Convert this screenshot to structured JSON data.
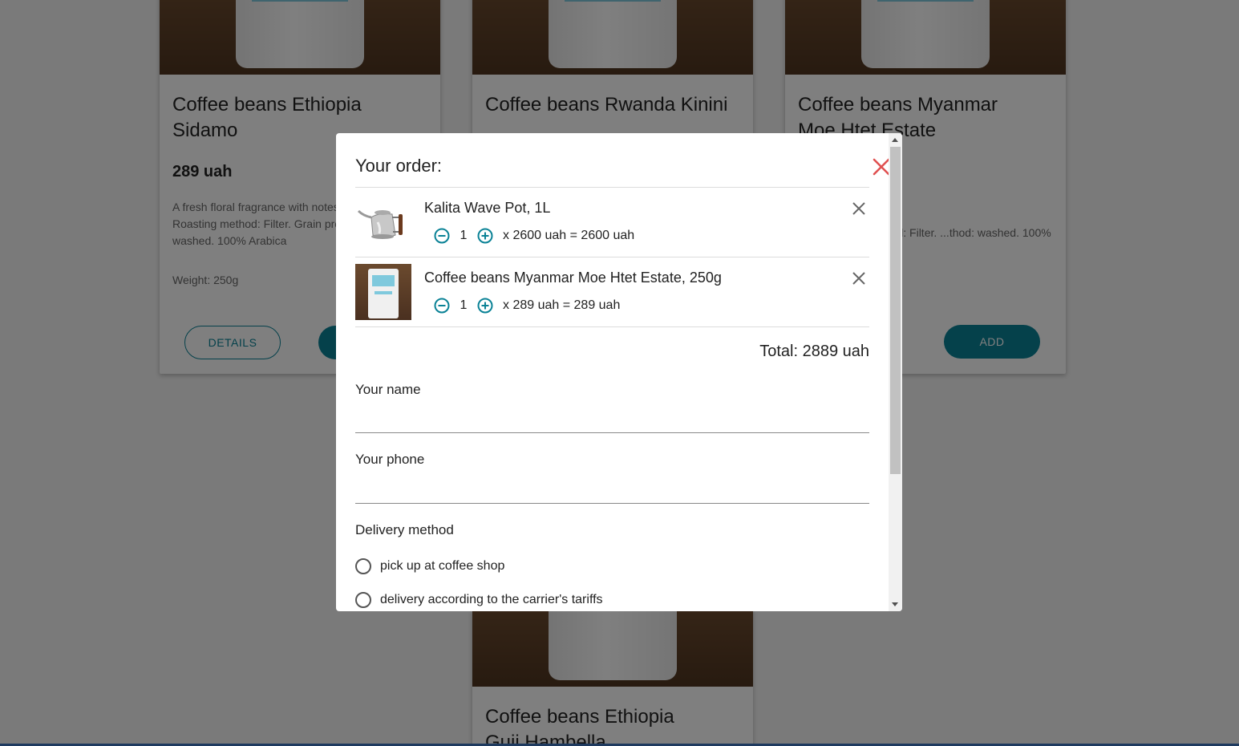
{
  "products": [
    {
      "title": "Coffee beans Ethiopia Sidamo",
      "price": "289 uah",
      "description": "A fresh floral fragrance with notes of bergamot. Roasting method: Filter. Grain processing method: washed. 100% Arabica",
      "weight": "Weight: 250g",
      "details_label": "DETAILS",
      "add_label": "ADD"
    },
    {
      "title": "Coffee beans Rwanda Kinini"
    },
    {
      "title": "Coffee beans Myanmar Moe Htet Estate",
      "description": "...y. Roasting method: Filter. ...thod: washed. 100% Arabica",
      "add_label": "ADD"
    },
    {
      "title": "Coffee beans Ethiopia Guji Hambella"
    }
  ],
  "order": {
    "title": "Your order:",
    "items": [
      {
        "name": "Kalita Wave Pot, 1L",
        "qty": "1",
        "expr": "x 2600 uah = 2600 uah"
      },
      {
        "name": "Coffee beans Myanmar Moe Htet Estate, 250g",
        "qty": "1",
        "expr": "x 289 uah = 289 uah"
      }
    ],
    "total": "Total: 2889 uah",
    "name_label": "Your name",
    "phone_label": "Your phone",
    "delivery_label": "Delivery method",
    "delivery_options": [
      "pick up at coffee shop",
      "delivery according to the carrier's tariffs"
    ]
  },
  "colors": {
    "accent": "#0a8296",
    "close": "#e05050"
  }
}
